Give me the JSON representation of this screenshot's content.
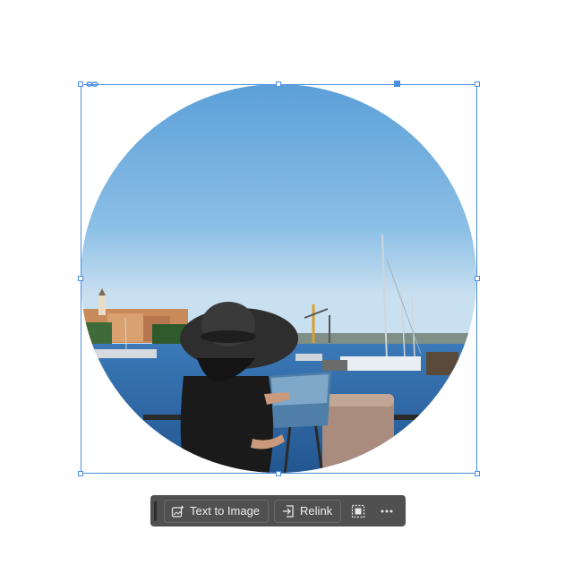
{
  "canvas": {
    "image_semantic": "woman in wide-brimmed black hat painting at an easel by a harbor with sailboats",
    "colors": {
      "sky_top": "#5a9fd8",
      "sky_bottom": "#c9e0f0",
      "water": "#2f6aa8",
      "selection": "#4a8de0"
    }
  },
  "taskbar": {
    "text_to_image_label": "Text to Image",
    "text_to_image_icon": "sparkle-image-icon",
    "relink_label": "Relink",
    "relink_icon": "relink-icon",
    "select_icon": "select-subject-icon",
    "more_icon": "more-icon",
    "background": "#505050"
  }
}
